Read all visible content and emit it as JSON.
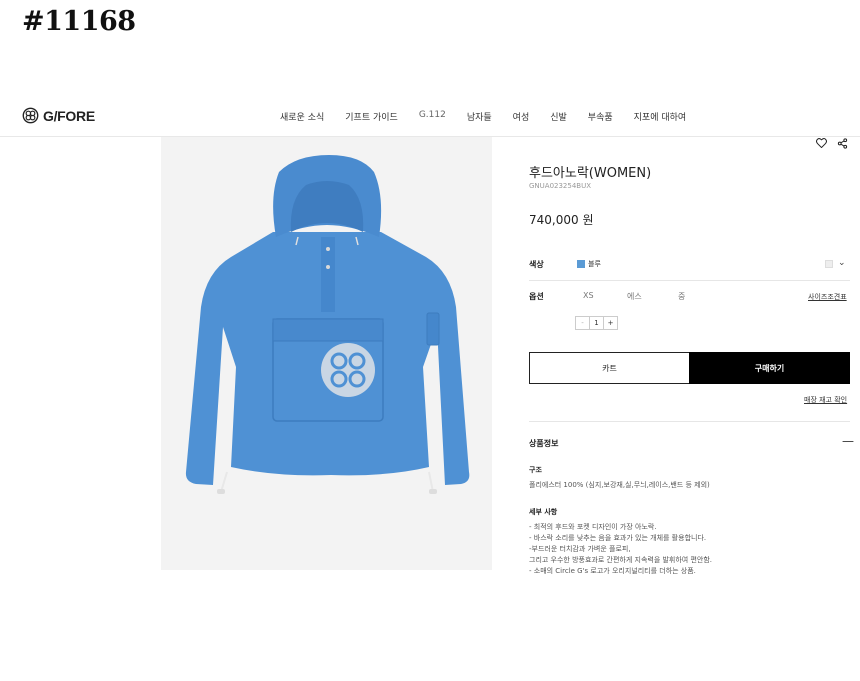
{
  "item_id": "#11168",
  "brand": {
    "logo_text": "G/FORE"
  },
  "nav": [
    {
      "label": "새로운 소식"
    },
    {
      "label": "기프트 가이드"
    },
    {
      "label": "G.112"
    },
    {
      "label": "남자들"
    },
    {
      "label": "여성"
    },
    {
      "label": "신발"
    },
    {
      "label": "부속품"
    },
    {
      "label": "지포에 대하여"
    }
  ],
  "product": {
    "title": "후드아노락(WOMEN)",
    "sku": "GNUA023254BUX",
    "price": "740,000 원",
    "color_label": "색상",
    "color_name": "블루",
    "color_hex": "#5b9bd5",
    "option_label": "옵션",
    "sizes": [
      "XS",
      "에스",
      "중"
    ],
    "size_guide": "사이즈조견표",
    "quantity": "1",
    "minus": "-",
    "plus": "+",
    "cart_label": "카트",
    "buy_label": "구매하기",
    "stock_link": "매장 재고 확인"
  },
  "info": {
    "title": "상품정보",
    "toggle": "—",
    "material_heading": "구조",
    "material_text": "폴리에스터 100% (심지,보강재,실,무늬,레이스,밴드 등 제외)",
    "details_heading": "세부 사항",
    "details": [
      "- 최적의 후드와 포켓 디자인이 가장 아노락.",
      "- 바스락 소리를 낮추는 음을 효과가 있는 개체를 활용합니다.",
      "-부드러운 터치감과 가벼운 플로피,",
      "그리고 우수한 방풍효과로 간편하게 지속력을 발휘하여 편안함.",
      "- 소매의 Circle G's 로고가 오리지널리티를 더하는 상품."
    ]
  }
}
